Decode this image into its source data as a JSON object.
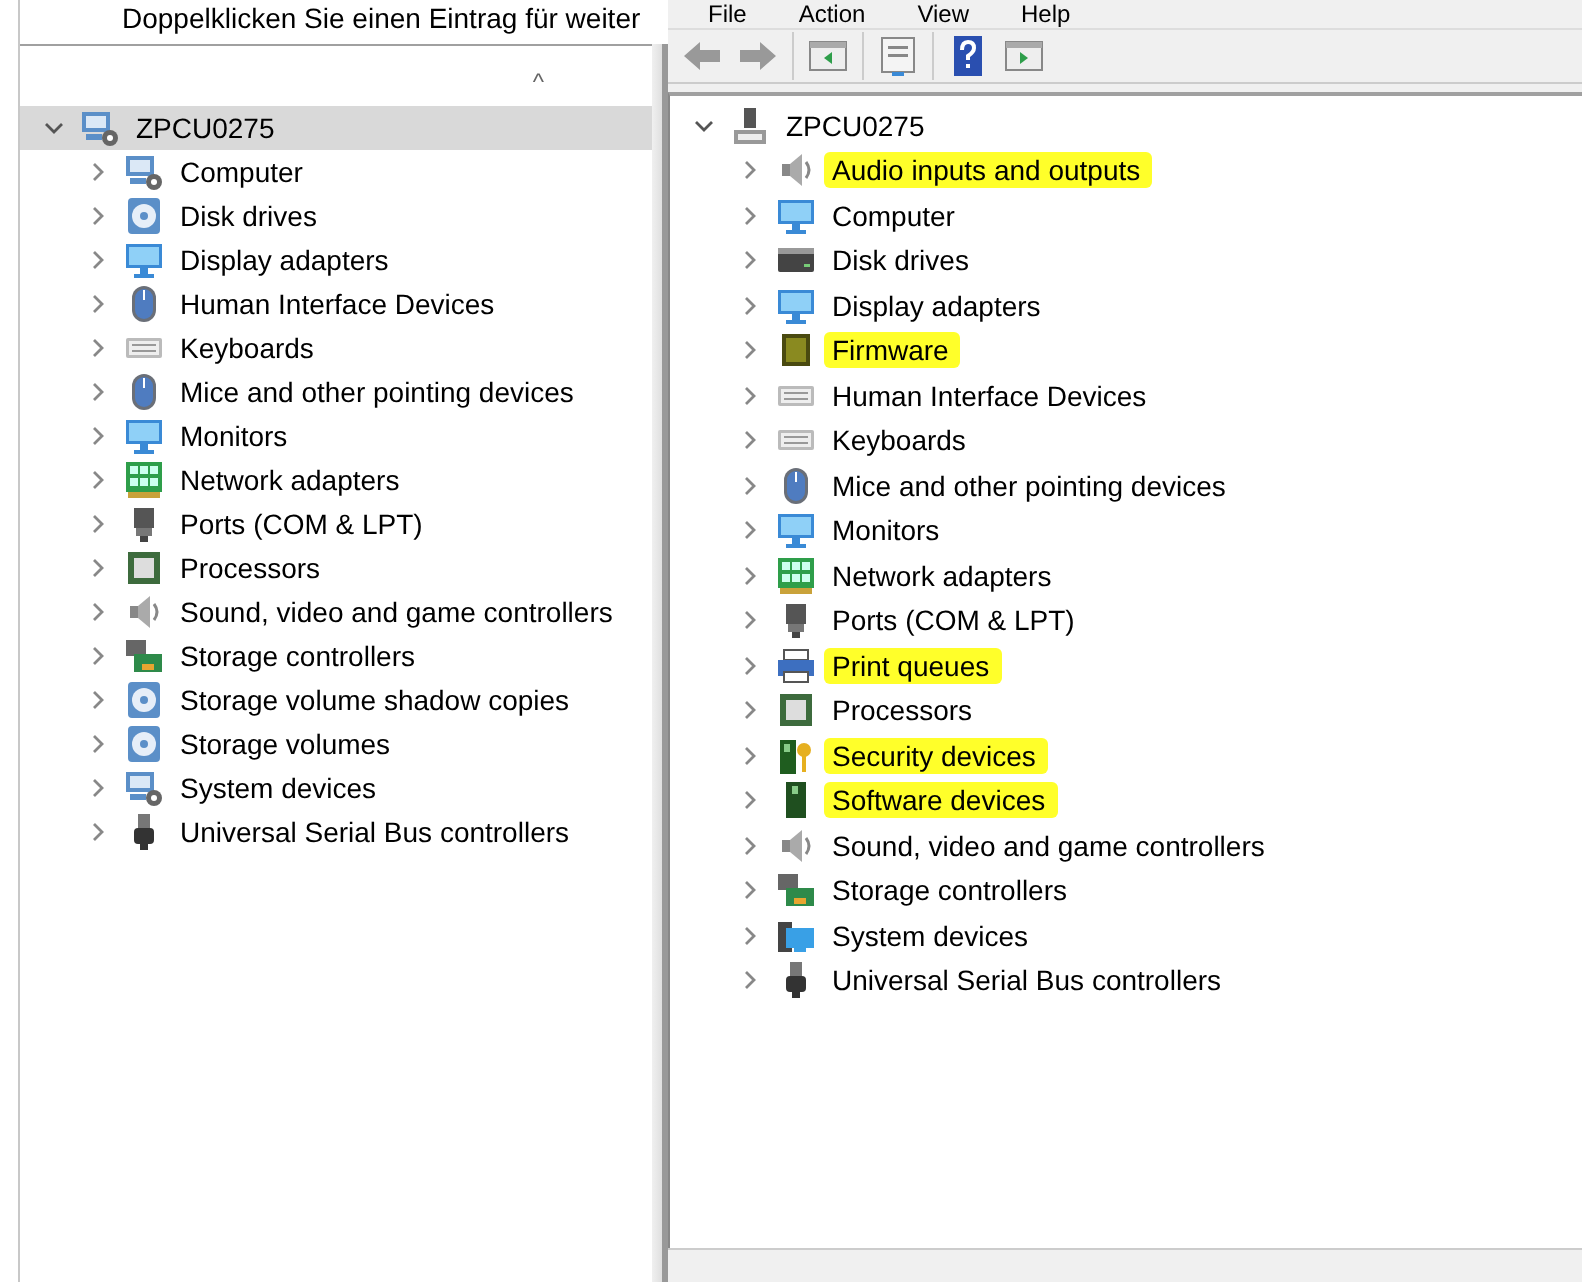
{
  "left_panel": {
    "hint": "Doppelklicken Sie einen Eintrag für weiter",
    "sort_indicator": "^",
    "tree": {
      "label": "ZPCU0275",
      "kind": "computer",
      "expanded": true,
      "selected": true,
      "children": [
        {
          "label": "Computer",
          "kind": "computer",
          "expanded": false
        },
        {
          "label": "Disk drives",
          "kind": "volume",
          "expanded": false
        },
        {
          "label": "Display adapters",
          "kind": "monitor",
          "expanded": false
        },
        {
          "label": "Human Interface Devices",
          "kind": "mouse",
          "expanded": false
        },
        {
          "label": "Keyboards",
          "kind": "keyboard",
          "expanded": false
        },
        {
          "label": "Mice and other pointing devices",
          "kind": "mouse",
          "expanded": false
        },
        {
          "label": "Monitors",
          "kind": "monitor",
          "expanded": false
        },
        {
          "label": "Network adapters",
          "kind": "network",
          "expanded": false
        },
        {
          "label": "Ports (COM & LPT)",
          "kind": "port",
          "expanded": false
        },
        {
          "label": "Processors",
          "kind": "chip",
          "expanded": false
        },
        {
          "label": "Sound, video and game controllers",
          "kind": "speaker",
          "expanded": false
        },
        {
          "label": "Storage controllers",
          "kind": "storage",
          "expanded": false
        },
        {
          "label": "Storage volume shadow copies",
          "kind": "volume",
          "expanded": false
        },
        {
          "label": "Storage volumes",
          "kind": "volume",
          "expanded": false
        },
        {
          "label": "System devices",
          "kind": "computer",
          "expanded": false
        },
        {
          "label": "Universal Serial Bus controllers",
          "kind": "usb",
          "expanded": false
        }
      ]
    }
  },
  "right_window": {
    "menu": [
      "File",
      "Action",
      "View",
      "Help"
    ],
    "tree": {
      "label": "ZPCU0275",
      "kind": "pc",
      "expanded": true,
      "children": [
        {
          "label": "Audio inputs and outputs",
          "kind": "speaker",
          "expanded": false,
          "highlighted": true
        },
        {
          "label": "Computer",
          "kind": "monitor",
          "expanded": false,
          "highlighted": false
        },
        {
          "label": "Disk drives",
          "kind": "disk",
          "expanded": false,
          "highlighted": false
        },
        {
          "label": "Display adapters",
          "kind": "monitor",
          "expanded": false,
          "highlighted": false
        },
        {
          "label": "Firmware",
          "kind": "firmware",
          "expanded": false,
          "highlighted": true
        },
        {
          "label": "Human Interface Devices",
          "kind": "keyboard",
          "expanded": false,
          "highlighted": false
        },
        {
          "label": "Keyboards",
          "kind": "keyboard",
          "expanded": false,
          "highlighted": false
        },
        {
          "label": "Mice and other pointing devices",
          "kind": "mouse",
          "expanded": false,
          "highlighted": false
        },
        {
          "label": "Monitors",
          "kind": "monitor",
          "expanded": false,
          "highlighted": false
        },
        {
          "label": "Network adapters",
          "kind": "network",
          "expanded": false,
          "highlighted": false
        },
        {
          "label": "Ports (COM & LPT)",
          "kind": "port",
          "expanded": false,
          "highlighted": false
        },
        {
          "label": "Print queues",
          "kind": "printer",
          "expanded": false,
          "highlighted": true
        },
        {
          "label": "Processors",
          "kind": "chip",
          "expanded": false,
          "highlighted": false
        },
        {
          "label": "Security devices",
          "kind": "security",
          "expanded": false,
          "highlighted": true
        },
        {
          "label": "Software devices",
          "kind": "software",
          "expanded": false,
          "highlighted": true
        },
        {
          "label": "Sound, video and game controllers",
          "kind": "speaker",
          "expanded": false,
          "highlighted": false
        },
        {
          "label": "Storage controllers",
          "kind": "storage",
          "expanded": false,
          "highlighted": false
        },
        {
          "label": "System devices",
          "kind": "system",
          "expanded": false,
          "highlighted": false
        },
        {
          "label": "Universal Serial Bus controllers",
          "kind": "usb",
          "expanded": false,
          "highlighted": false
        }
      ]
    }
  }
}
